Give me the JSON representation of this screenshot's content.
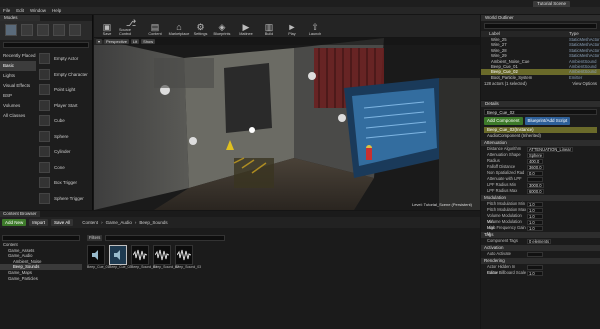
{
  "window": {
    "app_tab": "Tutorial Scene"
  },
  "menu": [
    "File",
    "Edit",
    "Window",
    "Help"
  ],
  "modes": {
    "tab": "Modes",
    "categories": [
      "Recently Placed",
      "Basic",
      "Lights",
      "Visual Effects",
      "BSP",
      "Volumes",
      "All Classes"
    ],
    "selected_category": 1,
    "place_items": [
      "Empty Actor",
      "Empty Character",
      "Point Light",
      "Player Start",
      "Cube",
      "Sphere",
      "Cylinder",
      "Cone",
      "Box Trigger",
      "Sphere Trigger"
    ]
  },
  "toolbar": {
    "buttons": [
      {
        "label": "Save",
        "icon": "save-icon"
      },
      {
        "label": "Source Control",
        "icon": "source-control-icon"
      },
      {
        "label": "Content",
        "icon": "content-icon"
      },
      {
        "label": "Marketplace",
        "icon": "marketplace-icon"
      },
      {
        "label": "Settings",
        "icon": "settings-icon"
      },
      {
        "label": "Blueprints",
        "icon": "blueprints-icon"
      },
      {
        "label": "Matinee",
        "icon": "matinee-icon"
      },
      {
        "label": "Build",
        "icon": "build-icon"
      },
      {
        "label": "Play",
        "icon": "play-icon"
      },
      {
        "label": "Launch",
        "icon": "launch-icon"
      }
    ]
  },
  "viewport": {
    "controls": [
      "▾",
      "Perspective",
      "Lit",
      "Show"
    ],
    "level_label": "Level: Tutorial_Scene (Persistent)"
  },
  "outliner": {
    "tab": "World Outliner",
    "col_label": "Label",
    "col_type": "Type",
    "rows": [
      {
        "name": "Wire_25",
        "type": "StaticMeshActor"
      },
      {
        "name": "Wire_27",
        "type": "StaticMeshActor"
      },
      {
        "name": "Wire_28",
        "type": "StaticMeshActor"
      },
      {
        "name": "Wire_29",
        "type": "StaticMeshActor"
      },
      {
        "name": "Ambient_Noise_Cue",
        "type": "AmbientSound"
      },
      {
        "name": "Beep_Cue_01",
        "type": "AmbientSound"
      },
      {
        "name": "Beep_Cue_02",
        "type": "AmbientSound"
      },
      {
        "name": "Boot_Particle_System",
        "type": "Emitter"
      }
    ],
    "selected_row": 6,
    "footer_count": "128 actors (1 selected)",
    "view_options": "View Options"
  },
  "details": {
    "tab": "Details",
    "name_value": "Beep_Cue_02",
    "add_component": "Add Component",
    "blueprint_btn": "Blueprint/Add Script",
    "components": [
      "Beep_Cue_02(Instance)",
      "AudioComponent (Inherited)"
    ],
    "sections": [
      {
        "title": "Attenuation",
        "props": [
          {
            "k": "Distance Algorithm",
            "v": "ATTENUATION_Linear"
          },
          {
            "k": "Attenuation Shape",
            "v": "Sphere"
          },
          {
            "k": "Radius",
            "v": "400.0"
          },
          {
            "k": "Falloff Distance",
            "v": "3600.0"
          },
          {
            "k": "Non Spatialized Rad",
            "v": "0.0"
          },
          {
            "k": "Attenuate with LPF",
            "v": ""
          },
          {
            "k": "LPF Radius Min",
            "v": "3000.0"
          },
          {
            "k": "LPF Radius Max",
            "v": "6000.0"
          }
        ]
      },
      {
        "title": "Modulation",
        "props": [
          {
            "k": "Pitch Modulation Min",
            "v": "1.0"
          },
          {
            "k": "Pitch Modulation Max",
            "v": "1.0"
          },
          {
            "k": "Volume Modulation Min",
            "v": "1.0"
          },
          {
            "k": "Volume Modulation Max",
            "v": "1.0"
          },
          {
            "k": "High Frequency Gain M",
            "v": "1.0"
          }
        ]
      },
      {
        "title": "Tags",
        "props": [
          {
            "k": "Component Tags",
            "v": "0 elements"
          }
        ]
      },
      {
        "title": "Activation",
        "props": [
          {
            "k": "Auto Activate",
            "v": ""
          }
        ]
      },
      {
        "title": "Rendering",
        "props": [
          {
            "k": "Actor Hidden In Game",
            "v": ""
          },
          {
            "k": "Editor Billboard Scale",
            "v": "1.0"
          }
        ]
      }
    ]
  },
  "content": {
    "tab": "Content Browser",
    "add_new": "Add New",
    "import": "Import",
    "save_all": "Save All",
    "breadcrumbs": [
      "Content",
      "Game_Audio",
      "Beep_Sounds"
    ],
    "filters": "Filters",
    "tree": [
      {
        "label": "Content",
        "indent": 0
      },
      {
        "label": "Game_Assets",
        "indent": 1
      },
      {
        "label": "Game_Audio",
        "indent": 1
      },
      {
        "label": "Ambient_Noise",
        "indent": 2
      },
      {
        "label": "Beep_Sounds",
        "indent": 2
      },
      {
        "label": "Game_Maps",
        "indent": 1
      },
      {
        "label": "Game_Particles",
        "indent": 1
      }
    ],
    "selected_tree": 4,
    "tiles": [
      "Beep_Cue_01",
      "Beep_Cue_02",
      "Beep_Sound_01",
      "Beep_Sound_02",
      "Beep_Sound_03"
    ],
    "selected_tile": 1
  }
}
